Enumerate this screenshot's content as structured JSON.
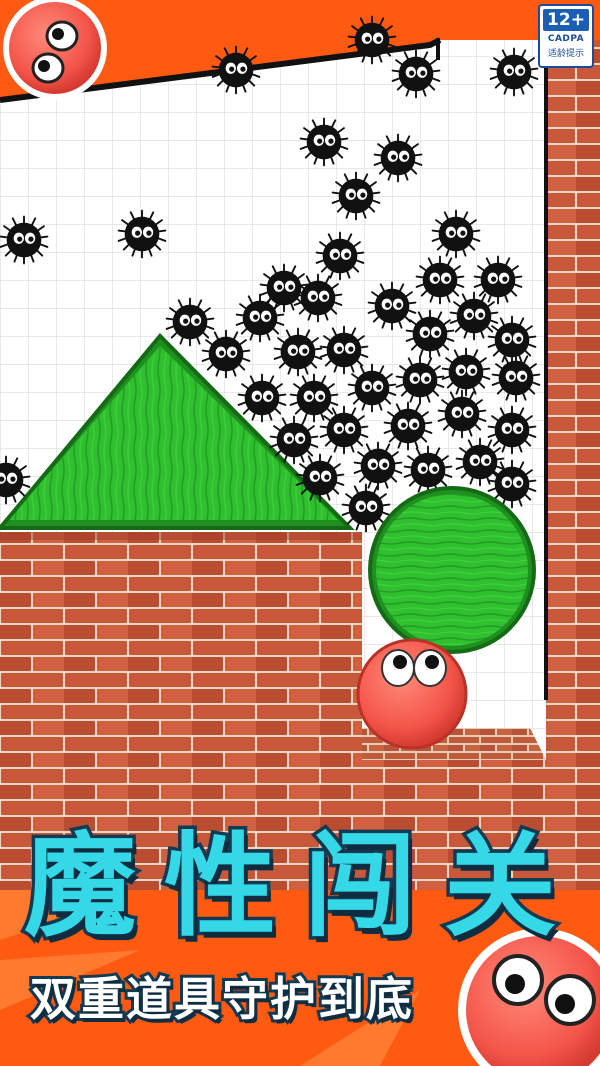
{
  "rating": {
    "age": "12+",
    "org": "CADPA",
    "tip": "适龄提示"
  },
  "headline": {
    "chars": [
      "魔",
      "性",
      "闯",
      "关"
    ]
  },
  "subline": "双重道具守护到底",
  "colors": {
    "accent_orange": "#ff5a12",
    "title_cyan": "#35d8e6",
    "title_outline": "#123a52",
    "brick": "#c8583a",
    "wood_green": "#2fbf2f",
    "red_ball": "#f4564a",
    "soot": "#111111"
  },
  "scene": {
    "soot_sprites": "soot-sprite-icon",
    "hero": "red-ball-icon",
    "wood_triangle": "green-wood-triangle",
    "wood_ball": "green-wood-ball"
  }
}
